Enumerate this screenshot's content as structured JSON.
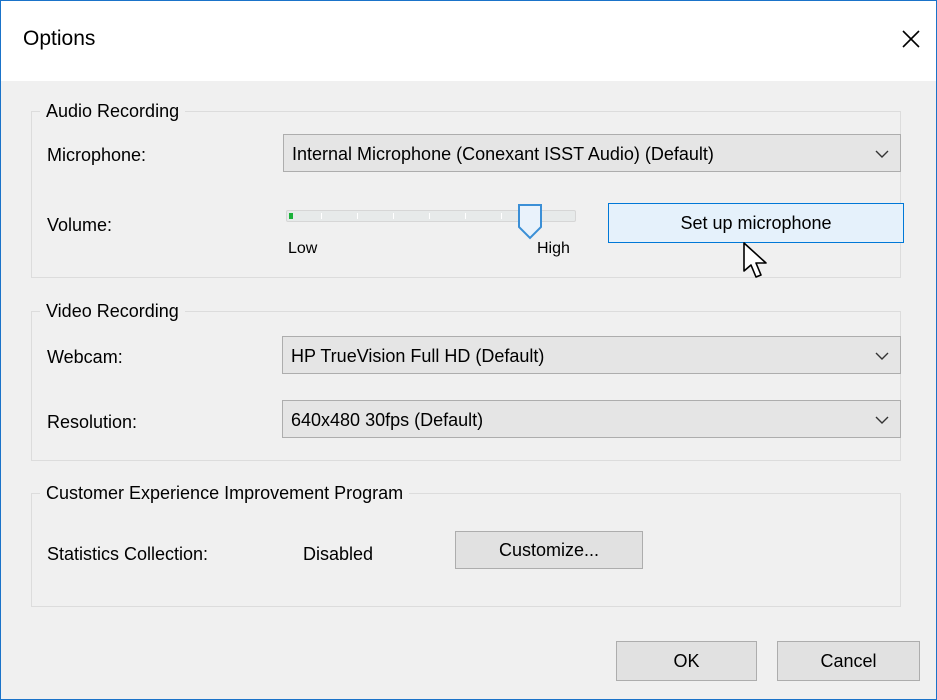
{
  "window": {
    "title": "Options"
  },
  "audio": {
    "group_title": "Audio Recording",
    "microphone_label": "Microphone:",
    "microphone_value": "Internal Microphone (Conexant ISST Audio) (Default)",
    "volume_label": "Volume:",
    "volume_level": 0.84,
    "slider_low": "Low",
    "slider_high": "High",
    "setup_button": "Set up microphone"
  },
  "video": {
    "group_title": "Video Recording",
    "webcam_label": "Webcam:",
    "webcam_value": "HP TrueVision Full HD (Default)",
    "resolution_label": "Resolution:",
    "resolution_value": "640x480 30fps (Default)"
  },
  "ceip": {
    "group_title": "Customer Experience Improvement Program",
    "stats_label": "Statistics Collection:",
    "stats_value": "Disabled",
    "customize_button": "Customize..."
  },
  "footer": {
    "ok_button": "OK",
    "cancel_button": "Cancel"
  },
  "colors": {
    "accent": "#0078d7",
    "slider_fill": "#1bb13a",
    "dialog_bg": "#f0f0f0"
  },
  "icons": {
    "close": "close-icon",
    "dropdown": "chevron-down-icon",
    "cursor": "mouse-pointer-icon"
  }
}
